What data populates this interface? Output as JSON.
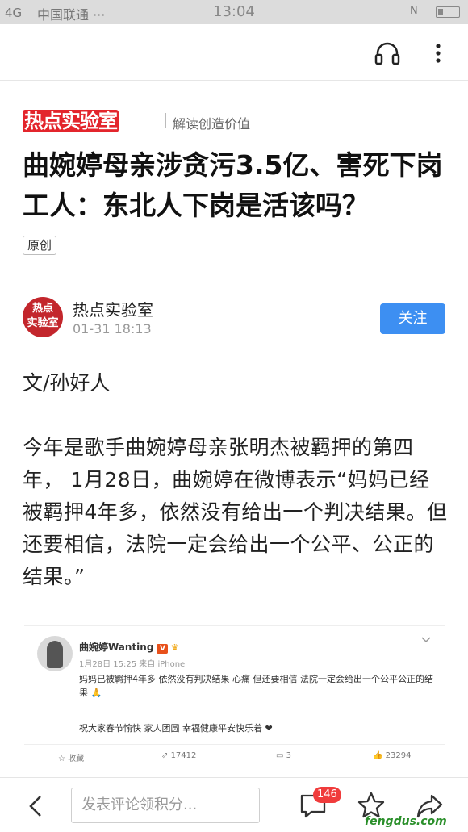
{
  "status_bar": {
    "signal": "4G",
    "carrier": "中国联通 ···",
    "time": "13:04",
    "nfc": "N",
    "battery": "battery"
  },
  "top_bar": {
    "icons": [
      "headphones-icon",
      "more-vertical-icon"
    ]
  },
  "brand": {
    "logo_text": "热点实验室",
    "slogan": "解读创造价值"
  },
  "article": {
    "title": "曲婉婷母亲涉贪污3.5亿、害死下岗工人：东北人下岗是活该吗？",
    "tag": "原创",
    "author": {
      "name": "热点实验室",
      "time": "01-31 18:13",
      "avatar_text": "热点\n实验室",
      "follow_label": "关注"
    },
    "byline": "文/孙好人",
    "paragraph": "今年是歌手曲婉婷母亲张明杰被羁押的第四年， 1月28日，曲婉婷在微博表示“妈妈已经被羁押4年多，依然没有给出一个判决结果。但还要相信，法院一定会给出一个公平、公正的结果。”"
  },
  "weibo_embed": {
    "user": "曲婉婷Wanting",
    "verified": "V",
    "meta": "1月28日 15:25 来自 iPhone",
    "text": "妈妈已被羁押4年多 依然没有判决结果 心痛 但还要相信 法院一定会给出一个公平公正的结果 🙏",
    "text2": "祝大家春节愉快 家人团圆 幸福健康平安快乐着 ❤",
    "actions": {
      "favorite": "收藏",
      "repost": "17412",
      "comment": "3",
      "like": "23294"
    }
  },
  "bottom_bar": {
    "comment_placeholder": "发表评论领积分...",
    "comment_count": "146"
  },
  "watermark": "fengdus.com",
  "colors": {
    "brand_red": "#e3252c",
    "follow_blue": "#3d8ff2",
    "badge_red": "#f03c3c"
  }
}
